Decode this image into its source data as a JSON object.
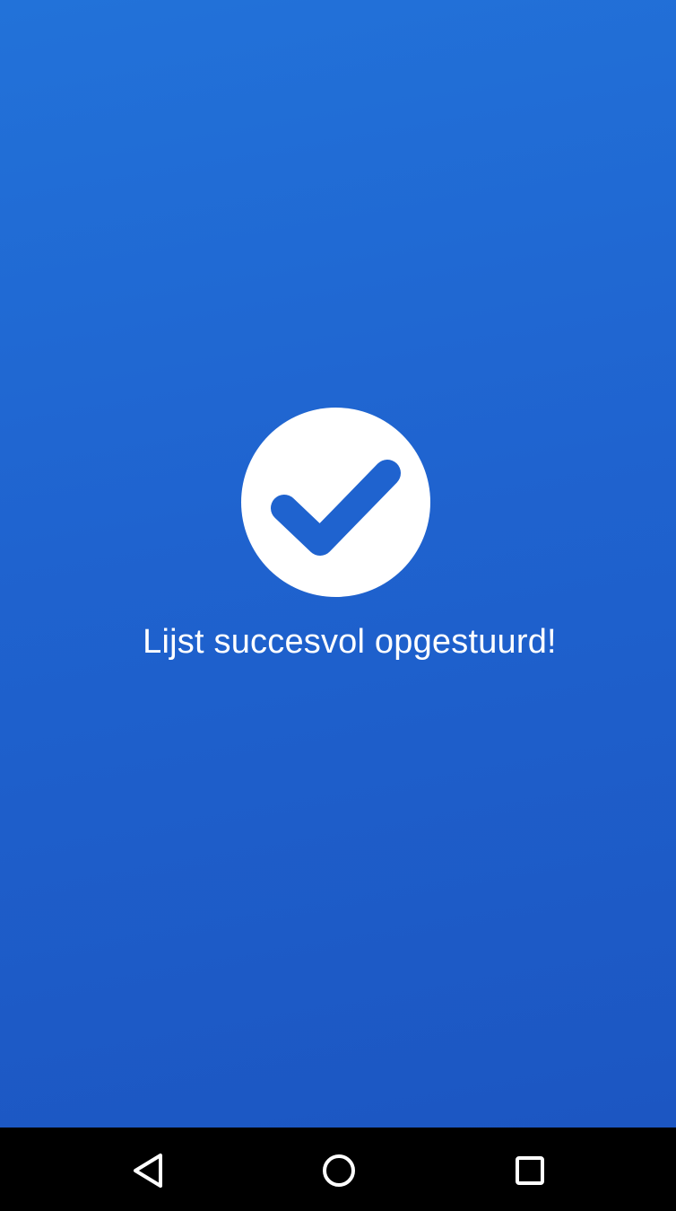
{
  "message": {
    "text": "Lijst succesvol opgestuurd!"
  },
  "success_icon": {
    "icon": "checkmark-icon",
    "circle_color": "#ffffff",
    "check_color": "#1f63cf"
  },
  "background": {
    "gradient_top": "#2272d9",
    "gradient_bottom": "#1c56c2"
  },
  "navigation_bar": {
    "back_icon": "back-triangle-icon",
    "home_icon": "home-circle-icon",
    "recents_icon": "recents-square-icon"
  }
}
